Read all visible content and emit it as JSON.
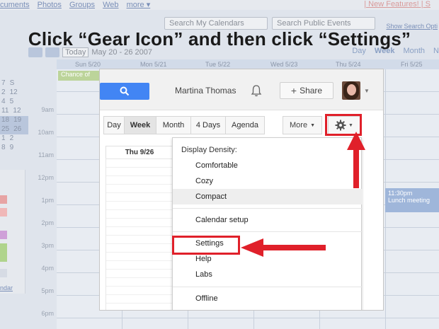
{
  "background": {
    "top_links": [
      "cuments",
      "Photos",
      "Groups",
      "Web",
      "more ▾"
    ],
    "top_right": "| New Features! | S",
    "search_my": "Search My Calendars",
    "search_public": "Search Public Events",
    "show_search": "Show Search Opti",
    "today": "Today",
    "date_range": "May 20 - 26 2007",
    "views": [
      "Day",
      "Week",
      "Month",
      "N"
    ],
    "days": [
      "Sun 5/20",
      "Mon 5/21",
      "Tue 5/22",
      "Wed 5/23",
      "Thu 5/24",
      "Fri 5/25"
    ],
    "times": [
      "9am",
      "10am",
      "11am",
      "12pm",
      "1pm",
      "2pm",
      "3pm",
      "4pm",
      "5pm",
      "6pm"
    ],
    "mini_rows": [
      [
        "7",
        "S"
      ],
      [
        "2",
        "12"
      ],
      [
        "4",
        "5"
      ],
      [
        "11",
        "12"
      ],
      [
        "18",
        "19"
      ],
      [
        "25",
        "26"
      ],
      [
        "1",
        "2"
      ],
      [
        "8",
        "9"
      ]
    ],
    "chance": "Chance of",
    "lunch_time": "11:30pm",
    "lunch_title": "Lunch meeting",
    "sidebar_link": "ndar",
    "swatch_colors": [
      "#e7a4a4",
      "#f0b8b8",
      "#cfa0d8",
      "#b0d48c",
      "#d6dbe4"
    ]
  },
  "title": "Click “Gear Icon” and then click “Settings”",
  "panel": {
    "user_name": "Martina Thomas",
    "share_label": "Share",
    "views": [
      "Day",
      "Week",
      "Month",
      "4 Days",
      "Agenda"
    ],
    "active_view": "Week",
    "more_label": "More",
    "day_header": "Thu 9/26",
    "menu": {
      "density_header": "Display Density:",
      "items": [
        "Comfortable",
        "Cozy",
        "Compact",
        "Calendar setup",
        "Settings",
        "Help",
        "Labs",
        "Offline"
      ],
      "selected": "Compact"
    }
  },
  "colors": {
    "highlight": "#e0202a",
    "search_blue": "#4285f4"
  }
}
